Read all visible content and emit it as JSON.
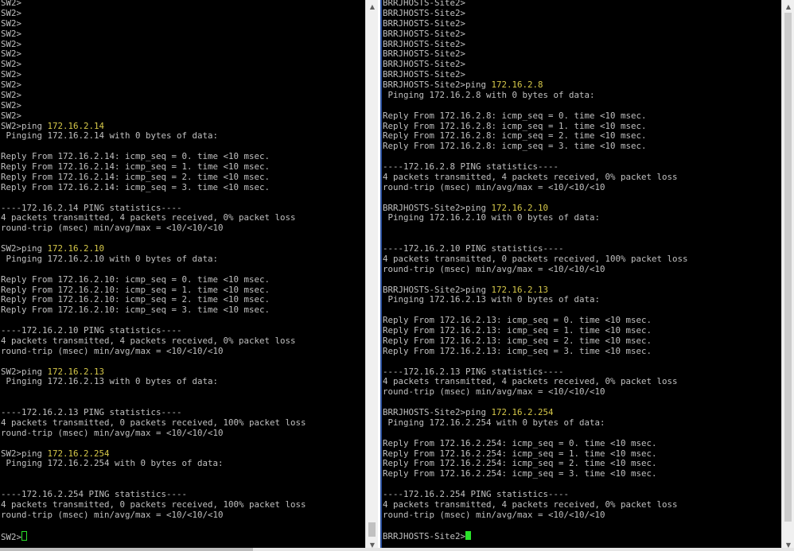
{
  "left_terminal": {
    "lines": [
      [
        {
          "t": "SW2>"
        }
      ],
      [
        {
          "t": "SW2>"
        }
      ],
      [
        {
          "t": "SW2>"
        }
      ],
      [
        {
          "t": "SW2>"
        }
      ],
      [
        {
          "t": "SW2>"
        }
      ],
      [
        {
          "t": "SW2>"
        }
      ],
      [
        {
          "t": "SW2>"
        }
      ],
      [
        {
          "t": "SW2>"
        }
      ],
      [
        {
          "t": "SW2>"
        }
      ],
      [
        {
          "t": "SW2>"
        }
      ],
      [
        {
          "t": "SW2>"
        }
      ],
      [
        {
          "t": "SW2>"
        }
      ],
      [
        {
          "t": "SW2>ping "
        },
        {
          "t": "172.16.2.14",
          "c": "ip"
        }
      ],
      [
        {
          "t": " Pinging 172.16.2.14 with 0 bytes of data:"
        }
      ],
      [
        {
          "t": ""
        }
      ],
      [
        {
          "t": "Reply From 172.16.2.14: icmp_seq = 0. time <10 msec."
        }
      ],
      [
        {
          "t": "Reply From 172.16.2.14: icmp_seq = 1. time <10 msec."
        }
      ],
      [
        {
          "t": "Reply From 172.16.2.14: icmp_seq = 2. time <10 msec."
        }
      ],
      [
        {
          "t": "Reply From 172.16.2.14: icmp_seq = 3. time <10 msec."
        }
      ],
      [
        {
          "t": ""
        }
      ],
      [
        {
          "t": "----172.16.2.14 PING statistics----"
        }
      ],
      [
        {
          "t": "4 packets transmitted, 4 packets received, 0% packet loss"
        }
      ],
      [
        {
          "t": "round-trip (msec) min/avg/max = <10/<10/<10"
        }
      ],
      [
        {
          "t": ""
        }
      ],
      [
        {
          "t": "SW2>ping "
        },
        {
          "t": "172.16.2.10",
          "c": "ip"
        }
      ],
      [
        {
          "t": " Pinging 172.16.2.10 with 0 bytes of data:"
        }
      ],
      [
        {
          "t": ""
        }
      ],
      [
        {
          "t": "Reply From 172.16.2.10: icmp_seq = 0. time <10 msec."
        }
      ],
      [
        {
          "t": "Reply From 172.16.2.10: icmp_seq = 1. time <10 msec."
        }
      ],
      [
        {
          "t": "Reply From 172.16.2.10: icmp_seq = 2. time <10 msec."
        }
      ],
      [
        {
          "t": "Reply From 172.16.2.10: icmp_seq = 3. time <10 msec."
        }
      ],
      [
        {
          "t": ""
        }
      ],
      [
        {
          "t": "----172.16.2.10 PING statistics----"
        }
      ],
      [
        {
          "t": "4 packets transmitted, 4 packets received, 0% packet loss"
        }
      ],
      [
        {
          "t": "round-trip (msec) min/avg/max = <10/<10/<10"
        }
      ],
      [
        {
          "t": ""
        }
      ],
      [
        {
          "t": "SW2>ping "
        },
        {
          "t": "172.16.2.13",
          "c": "ip"
        }
      ],
      [
        {
          "t": " Pinging 172.16.2.13 with 0 bytes of data:"
        }
      ],
      [
        {
          "t": ""
        }
      ],
      [
        {
          "t": ""
        }
      ],
      [
        {
          "t": "----172.16.2.13 PING statistics----"
        }
      ],
      [
        {
          "t": "4 packets transmitted, 0 packets received, 100% packet loss"
        }
      ],
      [
        {
          "t": "round-trip (msec) min/avg/max = <10/<10/<10"
        }
      ],
      [
        {
          "t": ""
        }
      ],
      [
        {
          "t": "SW2>ping "
        },
        {
          "t": "172.16.2.254",
          "c": "ip"
        }
      ],
      [
        {
          "t": " Pinging 172.16.2.254 with 0 bytes of data:"
        }
      ],
      [
        {
          "t": ""
        }
      ],
      [
        {
          "t": ""
        }
      ],
      [
        {
          "t": "----172.16.2.254 PING statistics----"
        }
      ],
      [
        {
          "t": "4 packets transmitted, 0 packets received, 100% packet loss"
        }
      ],
      [
        {
          "t": "round-trip (msec) min/avg/max = <10/<10/<10"
        }
      ],
      [
        {
          "t": ""
        }
      ],
      [
        {
          "t": "SW2>"
        },
        {
          "cursor": "l"
        }
      ]
    ]
  },
  "right_terminal": {
    "lines": [
      [
        {
          "t": "BRRJHOSTS-Site2>"
        }
      ],
      [
        {
          "t": "BRRJHOSTS-Site2>"
        }
      ],
      [
        {
          "t": "BRRJHOSTS-Site2>"
        }
      ],
      [
        {
          "t": "BRRJHOSTS-Site2>"
        }
      ],
      [
        {
          "t": "BRRJHOSTS-Site2>"
        }
      ],
      [
        {
          "t": "BRRJHOSTS-Site2>"
        }
      ],
      [
        {
          "t": "BRRJHOSTS-Site2>"
        }
      ],
      [
        {
          "t": "BRRJHOSTS-Site2>"
        }
      ],
      [
        {
          "t": "BRRJHOSTS-Site2>ping "
        },
        {
          "t": "172.16.2.8",
          "c": "ip"
        }
      ],
      [
        {
          "t": " Pinging 172.16.2.8 with 0 bytes of data:"
        }
      ],
      [
        {
          "t": ""
        }
      ],
      [
        {
          "t": "Reply From 172.16.2.8: icmp_seq = 0. time <10 msec."
        }
      ],
      [
        {
          "t": "Reply From 172.16.2.8: icmp_seq = 1. time <10 msec."
        }
      ],
      [
        {
          "t": "Reply From 172.16.2.8: icmp_seq = 2. time <10 msec."
        }
      ],
      [
        {
          "t": "Reply From 172.16.2.8: icmp_seq = 3. time <10 msec."
        }
      ],
      [
        {
          "t": ""
        }
      ],
      [
        {
          "t": "----172.16.2.8 PING statistics----"
        }
      ],
      [
        {
          "t": "4 packets transmitted, 4 packets received, 0% packet loss"
        }
      ],
      [
        {
          "t": "round-trip (msec) min/avg/max = <10/<10/<10"
        }
      ],
      [
        {
          "t": ""
        }
      ],
      [
        {
          "t": "BRRJHOSTS-Site2>ping "
        },
        {
          "t": "172.16.2.10",
          "c": "ip"
        }
      ],
      [
        {
          "t": " Pinging 172.16.2.10 with 0 bytes of data:"
        }
      ],
      [
        {
          "t": ""
        }
      ],
      [
        {
          "t": ""
        }
      ],
      [
        {
          "t": "----172.16.2.10 PING statistics----"
        }
      ],
      [
        {
          "t": "4 packets transmitted, 0 packets received, 100% packet loss"
        }
      ],
      [
        {
          "t": "round-trip (msec) min/avg/max = <10/<10/<10"
        }
      ],
      [
        {
          "t": ""
        }
      ],
      [
        {
          "t": "BRRJHOSTS-Site2>ping "
        },
        {
          "t": "172.16.2.13",
          "c": "ip"
        }
      ],
      [
        {
          "t": " Pinging 172.16.2.13 with 0 bytes of data:"
        }
      ],
      [
        {
          "t": ""
        }
      ],
      [
        {
          "t": "Reply From 172.16.2.13: icmp_seq = 0. time <10 msec."
        }
      ],
      [
        {
          "t": "Reply From 172.16.2.13: icmp_seq = 1. time <10 msec."
        }
      ],
      [
        {
          "t": "Reply From 172.16.2.13: icmp_seq = 2. time <10 msec."
        }
      ],
      [
        {
          "t": "Reply From 172.16.2.13: icmp_seq = 3. time <10 msec."
        }
      ],
      [
        {
          "t": ""
        }
      ],
      [
        {
          "t": "----172.16.2.13 PING statistics----"
        }
      ],
      [
        {
          "t": "4 packets transmitted, 4 packets received, 0% packet loss"
        }
      ],
      [
        {
          "t": "round-trip (msec) min/avg/max = <10/<10/<10"
        }
      ],
      [
        {
          "t": ""
        }
      ],
      [
        {
          "t": "BRRJHOSTS-Site2>ping "
        },
        {
          "t": "172.16.2.254",
          "c": "ip"
        }
      ],
      [
        {
          "t": " Pinging 172.16.2.254 with 0 bytes of data:"
        }
      ],
      [
        {
          "t": ""
        }
      ],
      [
        {
          "t": "Reply From 172.16.2.254: icmp_seq = 0. time <10 msec."
        }
      ],
      [
        {
          "t": "Reply From 172.16.2.254: icmp_seq = 1. time <10 msec."
        }
      ],
      [
        {
          "t": "Reply From 172.16.2.254: icmp_seq = 2. time <10 msec."
        }
      ],
      [
        {
          "t": "Reply From 172.16.2.254: icmp_seq = 3. time <10 msec."
        }
      ],
      [
        {
          "t": ""
        }
      ],
      [
        {
          "t": "----172.16.2.254 PING statistics----"
        }
      ],
      [
        {
          "t": "4 packets transmitted, 4 packets received, 0% packet loss"
        }
      ],
      [
        {
          "t": "round-trip (msec) min/avg/max = <10/<10/<10"
        }
      ],
      [
        {
          "t": ""
        }
      ],
      [
        {
          "t": "BRRJHOSTS-Site2>"
        },
        {
          "cursor": "r"
        }
      ]
    ]
  },
  "scrollbars": {
    "up_icon": "▲",
    "down_icon": "▼"
  },
  "colors": {
    "background": "#000000",
    "text": "#c0c0c0",
    "ip_highlight": "#d7c94a",
    "cursor": "#29e129",
    "pane_border": "#2a4f9e"
  }
}
